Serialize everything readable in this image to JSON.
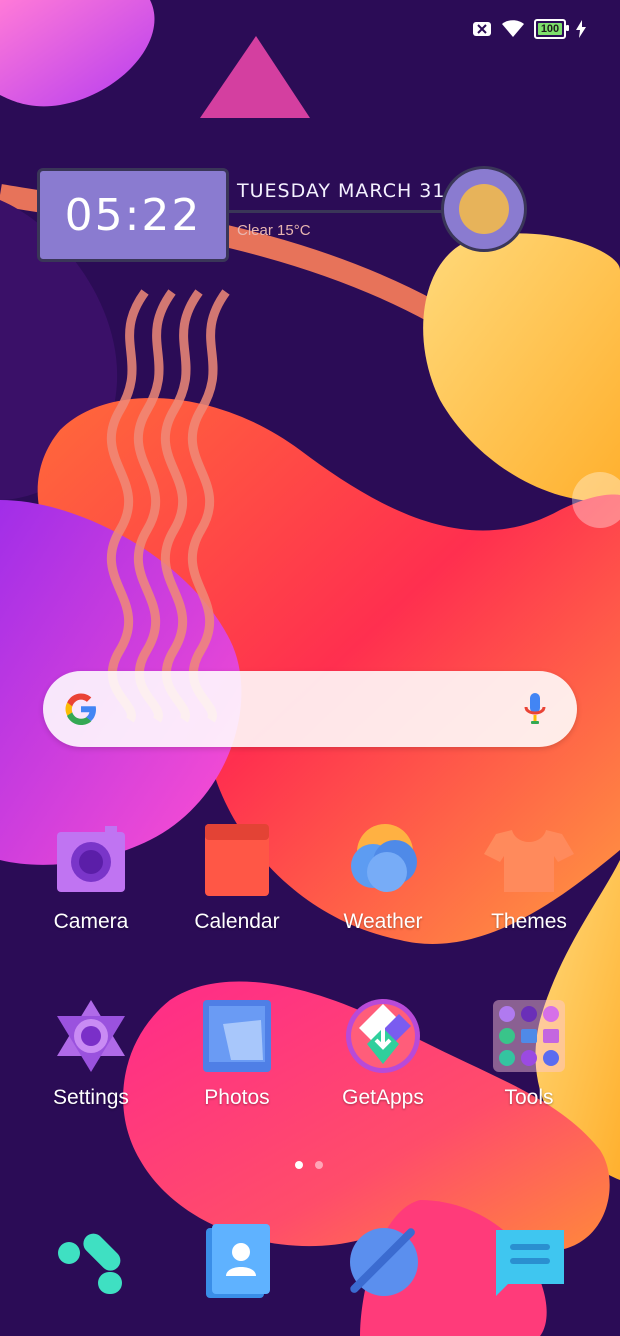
{
  "status_bar": {
    "icons": [
      "sim-x-icon",
      "wifi-icon",
      "battery-icon",
      "charging-bolt-icon"
    ],
    "battery_level": "100"
  },
  "clock_widget": {
    "time": "05:22",
    "date": "TUESDAY MARCH 31",
    "weather": "Clear 15°C"
  },
  "search_bar": {
    "icons": [
      "google-g-icon",
      "microphone-icon"
    ]
  },
  "apps": [
    {
      "label": "Camera",
      "icon": "camera-icon"
    },
    {
      "label": "Calendar",
      "icon": "calendar-icon"
    },
    {
      "label": "Weather",
      "icon": "weather-cloud-icon"
    },
    {
      "label": "Themes",
      "icon": "tshirt-icon"
    },
    {
      "label": "Settings",
      "icon": "settings-icon"
    },
    {
      "label": "Photos",
      "icon": "photos-icon"
    },
    {
      "label": "GetApps",
      "icon": "getapps-icon"
    },
    {
      "label": "Tools",
      "icon": "tools-folder-icon"
    }
  ],
  "page_indicator": {
    "pages": 2,
    "current": 1
  },
  "dock": [
    {
      "icon": "phone-icon"
    },
    {
      "icon": "contacts-icon"
    },
    {
      "icon": "browser-icon"
    },
    {
      "icon": "messages-icon"
    }
  ],
  "colors": {
    "background": "#2b0c56",
    "accent_orange": "#ff7a4c",
    "accent_yellow": "#ffd34d",
    "accent_pink": "#ff3b8a",
    "accent_purple": "#b341e8"
  }
}
